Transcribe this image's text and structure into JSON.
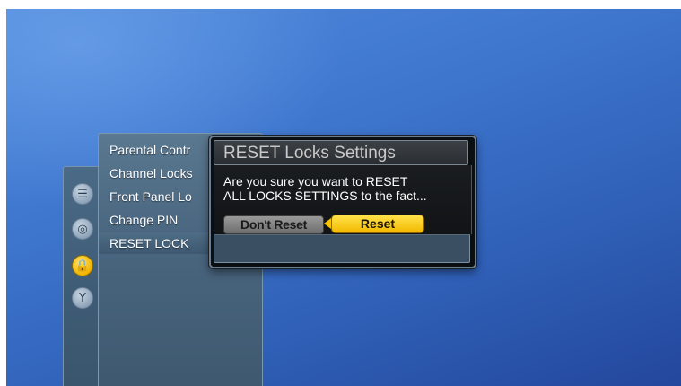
{
  "colors": {
    "background_blue": "#3f77cf",
    "panel_slate": "#4a6680",
    "dialog_black": "#0c0f12",
    "accent_yellow": "#f6c400",
    "button_gray": "#8a8a8a"
  },
  "icon_rail": {
    "icons": [
      {
        "name": "settings-sliders-icon",
        "glyph": "☰",
        "active": false
      },
      {
        "name": "signal-broadcast-icon",
        "glyph": "◎",
        "active": false
      },
      {
        "name": "lock-icon",
        "glyph": "🔒",
        "active": true
      },
      {
        "name": "antenna-icon",
        "glyph": "Y",
        "active": false
      }
    ]
  },
  "menu": {
    "items": [
      {
        "label": "Parental Contr"
      },
      {
        "label": "Channel Locks"
      },
      {
        "label": "Front Panel Lo"
      },
      {
        "label": "Change PIN"
      },
      {
        "label": "RESET LOCK"
      }
    ],
    "selected_index": 4
  },
  "dialog": {
    "title": "RESET Locks Settings",
    "message_line1": "Are you sure you want to RESET",
    "message_line2": "ALL LOCKS SETTINGS to the fact...",
    "dont_reset_label": "Don't Reset",
    "reset_label": "Reset"
  }
}
